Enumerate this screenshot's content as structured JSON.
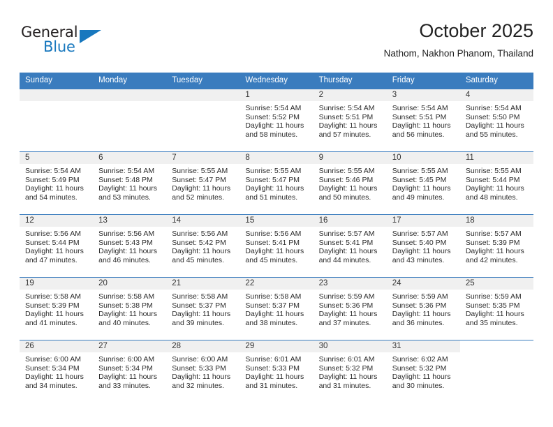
{
  "brand": {
    "name_part1": "General",
    "name_part2": "Blue",
    "triangle_color": "#1878be",
    "text_color": "#231f20"
  },
  "header": {
    "title": "October 2025",
    "subtitle": "Nathom, Nakhon Phanom, Thailand"
  },
  "theme": {
    "header_row_bg": "#3a7cbe",
    "header_row_text": "#ffffff",
    "daynum_strip_bg": "#f0f0f0",
    "cell_bg": "#ffffff",
    "row_border": "#3a7cbe"
  },
  "weekday_headers": [
    "Sunday",
    "Monday",
    "Tuesday",
    "Wednesday",
    "Thursday",
    "Friday",
    "Saturday"
  ],
  "labels": {
    "sunrise": "Sunrise:",
    "sunset": "Sunset:",
    "daylight": "Daylight:"
  },
  "weeks": [
    [
      {
        "empty": true
      },
      {
        "empty": true
      },
      {
        "empty": true
      },
      {
        "day": "1",
        "sunrise": "Sunrise: 5:54 AM",
        "sunset": "Sunset: 5:52 PM",
        "daylight": "Daylight: 11 hours and 58 minutes."
      },
      {
        "day": "2",
        "sunrise": "Sunrise: 5:54 AM",
        "sunset": "Sunset: 5:51 PM",
        "daylight": "Daylight: 11 hours and 57 minutes."
      },
      {
        "day": "3",
        "sunrise": "Sunrise: 5:54 AM",
        "sunset": "Sunset: 5:51 PM",
        "daylight": "Daylight: 11 hours and 56 minutes."
      },
      {
        "day": "4",
        "sunrise": "Sunrise: 5:54 AM",
        "sunset": "Sunset: 5:50 PM",
        "daylight": "Daylight: 11 hours and 55 minutes."
      }
    ],
    [
      {
        "day": "5",
        "sunrise": "Sunrise: 5:54 AM",
        "sunset": "Sunset: 5:49 PM",
        "daylight": "Daylight: 11 hours and 54 minutes."
      },
      {
        "day": "6",
        "sunrise": "Sunrise: 5:54 AM",
        "sunset": "Sunset: 5:48 PM",
        "daylight": "Daylight: 11 hours and 53 minutes."
      },
      {
        "day": "7",
        "sunrise": "Sunrise: 5:55 AM",
        "sunset": "Sunset: 5:47 PM",
        "daylight": "Daylight: 11 hours and 52 minutes."
      },
      {
        "day": "8",
        "sunrise": "Sunrise: 5:55 AM",
        "sunset": "Sunset: 5:47 PM",
        "daylight": "Daylight: 11 hours and 51 minutes."
      },
      {
        "day": "9",
        "sunrise": "Sunrise: 5:55 AM",
        "sunset": "Sunset: 5:46 PM",
        "daylight": "Daylight: 11 hours and 50 minutes."
      },
      {
        "day": "10",
        "sunrise": "Sunrise: 5:55 AM",
        "sunset": "Sunset: 5:45 PM",
        "daylight": "Daylight: 11 hours and 49 minutes."
      },
      {
        "day": "11",
        "sunrise": "Sunrise: 5:55 AM",
        "sunset": "Sunset: 5:44 PM",
        "daylight": "Daylight: 11 hours and 48 minutes."
      }
    ],
    [
      {
        "day": "12",
        "sunrise": "Sunrise: 5:56 AM",
        "sunset": "Sunset: 5:44 PM",
        "daylight": "Daylight: 11 hours and 47 minutes."
      },
      {
        "day": "13",
        "sunrise": "Sunrise: 5:56 AM",
        "sunset": "Sunset: 5:43 PM",
        "daylight": "Daylight: 11 hours and 46 minutes."
      },
      {
        "day": "14",
        "sunrise": "Sunrise: 5:56 AM",
        "sunset": "Sunset: 5:42 PM",
        "daylight": "Daylight: 11 hours and 45 minutes."
      },
      {
        "day": "15",
        "sunrise": "Sunrise: 5:56 AM",
        "sunset": "Sunset: 5:41 PM",
        "daylight": "Daylight: 11 hours and 45 minutes."
      },
      {
        "day": "16",
        "sunrise": "Sunrise: 5:57 AM",
        "sunset": "Sunset: 5:41 PM",
        "daylight": "Daylight: 11 hours and 44 minutes."
      },
      {
        "day": "17",
        "sunrise": "Sunrise: 5:57 AM",
        "sunset": "Sunset: 5:40 PM",
        "daylight": "Daylight: 11 hours and 43 minutes."
      },
      {
        "day": "18",
        "sunrise": "Sunrise: 5:57 AM",
        "sunset": "Sunset: 5:39 PM",
        "daylight": "Daylight: 11 hours and 42 minutes."
      }
    ],
    [
      {
        "day": "19",
        "sunrise": "Sunrise: 5:58 AM",
        "sunset": "Sunset: 5:39 PM",
        "daylight": "Daylight: 11 hours and 41 minutes."
      },
      {
        "day": "20",
        "sunrise": "Sunrise: 5:58 AM",
        "sunset": "Sunset: 5:38 PM",
        "daylight": "Daylight: 11 hours and 40 minutes."
      },
      {
        "day": "21",
        "sunrise": "Sunrise: 5:58 AM",
        "sunset": "Sunset: 5:37 PM",
        "daylight": "Daylight: 11 hours and 39 minutes."
      },
      {
        "day": "22",
        "sunrise": "Sunrise: 5:58 AM",
        "sunset": "Sunset: 5:37 PM",
        "daylight": "Daylight: 11 hours and 38 minutes."
      },
      {
        "day": "23",
        "sunrise": "Sunrise: 5:59 AM",
        "sunset": "Sunset: 5:36 PM",
        "daylight": "Daylight: 11 hours and 37 minutes."
      },
      {
        "day": "24",
        "sunrise": "Sunrise: 5:59 AM",
        "sunset": "Sunset: 5:36 PM",
        "daylight": "Daylight: 11 hours and 36 minutes."
      },
      {
        "day": "25",
        "sunrise": "Sunrise: 5:59 AM",
        "sunset": "Sunset: 5:35 PM",
        "daylight": "Daylight: 11 hours and 35 minutes."
      }
    ],
    [
      {
        "day": "26",
        "sunrise": "Sunrise: 6:00 AM",
        "sunset": "Sunset: 5:34 PM",
        "daylight": "Daylight: 11 hours and 34 minutes."
      },
      {
        "day": "27",
        "sunrise": "Sunrise: 6:00 AM",
        "sunset": "Sunset: 5:34 PM",
        "daylight": "Daylight: 11 hours and 33 minutes."
      },
      {
        "day": "28",
        "sunrise": "Sunrise: 6:00 AM",
        "sunset": "Sunset: 5:33 PM",
        "daylight": "Daylight: 11 hours and 32 minutes."
      },
      {
        "day": "29",
        "sunrise": "Sunrise: 6:01 AM",
        "sunset": "Sunset: 5:33 PM",
        "daylight": "Daylight: 11 hours and 31 minutes."
      },
      {
        "day": "30",
        "sunrise": "Sunrise: 6:01 AM",
        "sunset": "Sunset: 5:32 PM",
        "daylight": "Daylight: 11 hours and 31 minutes."
      },
      {
        "day": "31",
        "sunrise": "Sunrise: 6:02 AM",
        "sunset": "Sunset: 5:32 PM",
        "daylight": "Daylight: 11 hours and 30 minutes."
      },
      {
        "blank": true
      }
    ]
  ]
}
